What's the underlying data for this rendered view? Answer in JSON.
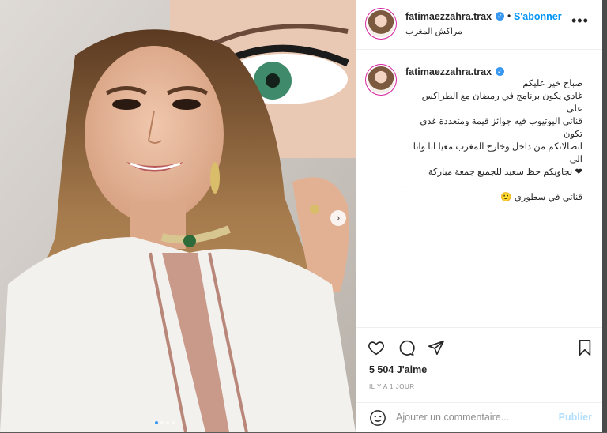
{
  "post": {
    "username": "fatimaezzahra.trax",
    "follow_label": "S'abonner",
    "separator": "•",
    "location": "مراكش المغرب",
    "more_label": "•••"
  },
  "caption": {
    "username": "fatimaezzahra.trax",
    "lines": [
      "صباح خير عليكم",
      "غادي يكون برنامج في رمضان مع الطراكس على",
      "قناتي اليوتيوب فيه جوائز قيمة ومتعددة غدي تكون",
      "اتصالاتكم من داخل وخارج المغرب معيا انا وانا الي",
      "❤ نجاوبكم حظ سعيد للجميع جمعة مباركة",
      "",
      "قناتي في سطوري 🙂"
    ],
    "dots": [
      ".",
      ".",
      ".",
      ".",
      ".",
      ".",
      ".",
      ".",
      "."
    ]
  },
  "actions": {
    "likes": "5 504 J'aime",
    "time": "IL Y A 1 JOUR",
    "comment_placeholder": "Ajouter un commentaire...",
    "post_label": "Publier"
  },
  "icons": {
    "like": "heart-icon",
    "comment": "comment-icon",
    "share": "share-icon",
    "save": "bookmark-icon",
    "emoji": "emoji-icon",
    "next": "chevron-right-icon"
  },
  "colors": {
    "accent": "#0095f6",
    "verified": "#3897f0",
    "post_disabled": "#b2dffc",
    "text": "#262626",
    "muted": "#8e8e8e"
  }
}
